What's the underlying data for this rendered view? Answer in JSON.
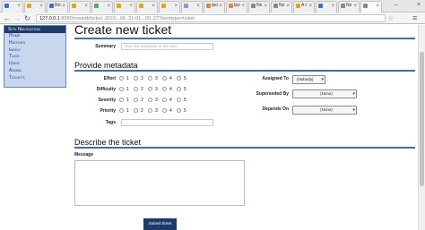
{
  "browser": {
    "tabs": [
      {
        "label": "",
        "favicon": "#3b6fd6"
      },
      {
        "label": "",
        "favicon": "#e6a700"
      },
      {
        "label": "Re:",
        "favicon": "#3b6fd6"
      },
      {
        "label": "",
        "favicon": "#e6a700"
      },
      {
        "label": "",
        "favicon": "#55aa55"
      },
      {
        "label": "",
        "favicon": "#e6a700"
      },
      {
        "label": "",
        "favicon": "#e6a700"
      },
      {
        "label": "",
        "favicon": "#e6a700"
      },
      {
        "label": "",
        "favicon": "#8899cc"
      },
      {
        "label": "tpo",
        "favicon": "#dd8833"
      },
      {
        "label": "tpo",
        "favicon": "#dd8833"
      },
      {
        "label": "Ne",
        "favicon": "#888888"
      },
      {
        "label": "Ne",
        "favicon": "#888888"
      },
      {
        "label": "A t",
        "favicon": "#e6a700"
      },
      {
        "label": "",
        "favicon": "#3b6fd6"
      },
      {
        "label": "Ne",
        "favicon": "#888888"
      },
      {
        "label": "",
        "favicon": "#888888"
      }
    ],
    "url_host": "127.0.0.1",
    "url_path": ":8080/rxwsdb/ticket..2015...06..21-01...00..27?itemtype=ticket",
    "nav_back_icon": "back-arrow-icon",
    "nav_forward_icon": "forward-arrow-icon",
    "nav_reload_icon": "reload-icon"
  },
  "sidebar": {
    "heading": "Site Navigation",
    "items": [
      "Home",
      "History",
      "Index",
      "Tags",
      "User",
      "Admin",
      "Tickets"
    ]
  },
  "page": {
    "title": "Create new ticket",
    "summary_label": "Summary",
    "summary_placeholder": "One line summary of the item",
    "metadata_heading": "Provide metadata",
    "effort_label": "Effort",
    "difficulty_label": "Difficulty",
    "severity_label": "Severity",
    "priority_label": "Priority",
    "tags_label": "Tags",
    "radio_values": [
      "1",
      "2",
      "3",
      "4",
      "5"
    ],
    "assigned_label": "Assigned To",
    "assigned_value": "(Nobody)",
    "superseded_label": "Superseded By",
    "superseded_value": "(None)",
    "depends_label": "Depends On",
    "depends_value": "(None)",
    "describe_heading": "Describe the ticket",
    "message_label": "Message",
    "submit_label": "Submit ticket"
  },
  "colors": {
    "accent": "#3e6fa8",
    "sidebar_bg": "#c8d6ee",
    "sidebar_head": "#1e3a6a",
    "submit_bg": "#1e3a6a"
  }
}
